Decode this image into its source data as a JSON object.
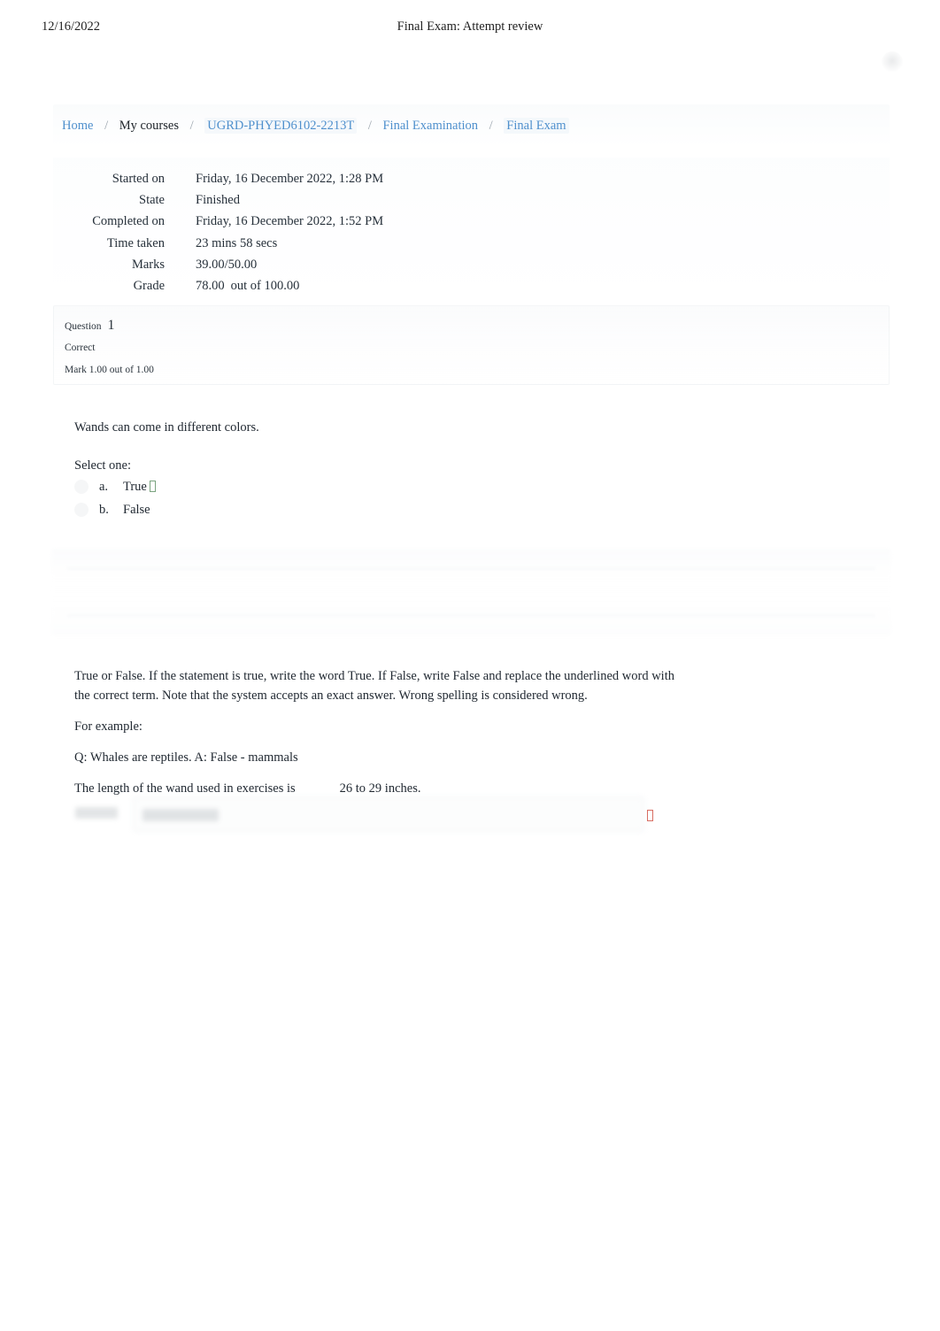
{
  "print": {
    "date": "12/16/2022",
    "title": "Final Exam: Attempt review"
  },
  "breadcrumb": {
    "separator": "/",
    "items": [
      {
        "label": "Home",
        "type": "link"
      },
      {
        "label": "My courses",
        "type": "plain"
      },
      {
        "label": "UGRD-PHYED6102-2213T",
        "type": "link"
      },
      {
        "label": "Final Examination",
        "type": "link"
      },
      {
        "label": "Final Exam",
        "type": "link"
      }
    ]
  },
  "summary": {
    "rows": [
      {
        "key": "Started on",
        "value": "Friday, 16 December 2022, 1:28 PM"
      },
      {
        "key": "State",
        "value": "Finished"
      },
      {
        "key": "Completed on",
        "value": "Friday, 16 December 2022, 1:52 PM"
      },
      {
        "key": "Time taken",
        "value": "23 mins 58 secs"
      },
      {
        "key": "Marks",
        "value": "39.00/50.00"
      }
    ],
    "grade_key": "Grade",
    "grade_value": "78.00",
    "grade_suffix": "out of 100.00"
  },
  "question1": {
    "label": "Question",
    "number": "1",
    "state": "Correct",
    "mark": "Mark 1.00 out of 1.00",
    "text": "Wands can come in different colors.",
    "select_one": "Select one:",
    "options": [
      {
        "letter": "a.",
        "text": "True",
        "marker": "correct"
      },
      {
        "letter": "b.",
        "text": "False",
        "marker": "none"
      }
    ]
  },
  "question2": {
    "instructions": "True or False. If the statement is true, write the word True. If False, write False and replace the underlined word with the correct term. Note that the system accepts an exact answer. Wrong spelling is considered wrong.",
    "example_label": "For example:",
    "example_qa": "Q: Whales are reptiles. A: False - mammals",
    "stem_before": "The length of the wand used in exercises is",
    "stem_after": "26 to 29 inches.",
    "answer_label": "Answer:",
    "answer_value": "",
    "answer_marker": "wrong"
  },
  "colors": {
    "link": "#4f90cd",
    "text": "#222a33",
    "correct_marker": "#7aa37f",
    "wrong_marker": "#d86d62"
  }
}
